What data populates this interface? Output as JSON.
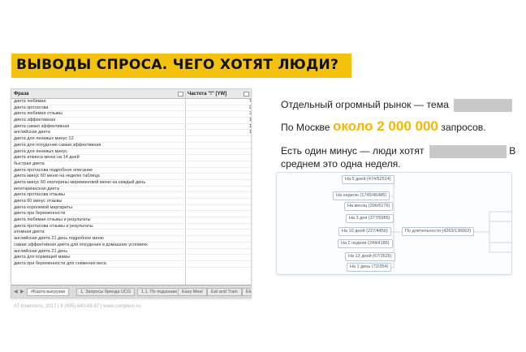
{
  "slide": {
    "title": "ВЫВОДЫ СПРОСА. ЧЕГО ХОТЯТ ЛЮДИ?",
    "footer": "AT Комплето, 2017 | 8 (495) 640-89-97 | www.complero.ru"
  },
  "sheet": {
    "col_query": "Фраза",
    "col_freq": "Частота \"!\" [YW]",
    "rows": [
      {
        "q": "диета любимая",
        "v": "7407"
      },
      {
        "q": "диета протасова",
        "v": "2469"
      },
      {
        "q": "диета любимая отзывы",
        "v": "2119"
      },
      {
        "q": "диета эффективная",
        "v": "1528"
      },
      {
        "q": "диета самая эффективная",
        "v": "1301"
      },
      {
        "q": "английская диета",
        "v": "1068"
      },
      {
        "q": "диета для ленивых минус 12",
        "v": "976"
      },
      {
        "q": "диета для похудения самая эффективная",
        "v": "856"
      },
      {
        "q": "диета для ленивых минус",
        "v": "836"
      },
      {
        "q": "диета аткинса меню на 14 дней",
        "v": "693"
      },
      {
        "q": "быстрая диета",
        "v": "653"
      },
      {
        "q": "диета протасова подробное описание",
        "v": "641"
      },
      {
        "q": "диета минус 60 меню на неделю таблица",
        "v": "603"
      },
      {
        "q": "диета минус 60 екатерины миримановой меню на каждый день",
        "v": "599"
      },
      {
        "q": "вегетарианская диета",
        "v": "521"
      },
      {
        "q": "диета протасова отзывы",
        "v": "471"
      },
      {
        "q": "диета 60 минус отзывы",
        "v": "468"
      },
      {
        "q": "диета королевой маргариты",
        "v": "459"
      },
      {
        "q": "диета при беременности",
        "v": "456"
      },
      {
        "q": "диета любимая отзывы и результаты",
        "v": "447"
      },
      {
        "q": "диета протасова отзывы и результаты",
        "v": "445"
      },
      {
        "q": "атомная диета",
        "v": "417"
      },
      {
        "q": "английская диета 21 день подробное меню",
        "v": "410"
      },
      {
        "q": "самая эффективная диета для похудения в домашних условиях",
        "v": "402"
      },
      {
        "q": "английская диета 21 день",
        "v": "370"
      },
      {
        "q": "диета для кормящей мамы",
        "v": "341"
      },
      {
        "q": "диета при беременности для снижения веса",
        "v": "338"
      }
    ],
    "tabs": [
      "#Карта выгрузки",
      "1. Запросы бренда UCG",
      "1.1. По подзонам",
      "Easy Meal",
      "Eat and Train",
      "Elemen"
    ]
  },
  "text": {
    "line1": "Отдельный огромный рынок — тема",
    "line2_pre": "По Москве",
    "line2_hl": "около 2 000 000",
    "line2_post": "запросов.",
    "line3_pre": "Есть один минус — люди хотят",
    "line3_post": "В",
    "line4": "среднем это одна неделя."
  },
  "tree": {
    "root": "По длительности (4263/136062)",
    "nodes": [
      "На 5 дней (474/52514)",
      "На неделю (1745/46486)",
      "На месяц (396/6176)",
      "На 3 дня (377/5985)",
      "На 10 дней (227/4456)",
      "На 2 недели (244/4186)",
      "На 13 дней (67/3526)",
      "На 1 день (72/354)"
    ]
  }
}
